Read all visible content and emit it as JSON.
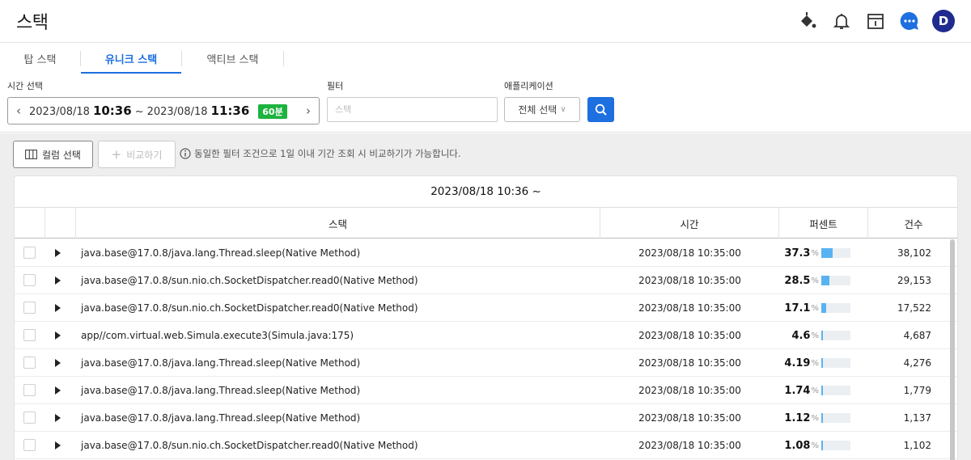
{
  "header": {
    "title": "스택"
  },
  "tabs": [
    {
      "label": "탑 스택",
      "active": false
    },
    {
      "label": "유니크 스택",
      "active": true
    },
    {
      "label": "액티브 스택",
      "active": false
    }
  ],
  "filters": {
    "time_label": "시간 선택",
    "range": {
      "start_date": "2023/08/18",
      "start_time": "10:36",
      "separator": "~",
      "end_date": "2023/08/18",
      "end_time": "11:36",
      "duration_badge": "60분"
    },
    "filter_label": "필터",
    "filter_placeholder": "스택",
    "app_label": "애플리케이션",
    "app_selected": "전체 선택"
  },
  "toolbar": {
    "column_select": "컬럼 선택",
    "compare": "비교하기",
    "info": "동일한 필터 조건으로 1일 이내 기간 조회 시 비교하기가 가능합니다."
  },
  "table": {
    "title": "2023/08/18 10:36 ~",
    "columns": [
      "스택",
      "시간",
      "퍼센트",
      "건수"
    ],
    "percent_symbol": "%",
    "rows": [
      {
        "stack": "java.base@17.0.8/java.lang.Thread.sleep(Native Method)",
        "time": "2023/08/18 10:35:00",
        "percent": "37.3",
        "fill": 0.373,
        "count": "38,102"
      },
      {
        "stack": "java.base@17.0.8/sun.nio.ch.SocketDispatcher.read0(Native Method)",
        "time": "2023/08/18 10:35:00",
        "percent": "28.5",
        "fill": 0.285,
        "count": "29,153"
      },
      {
        "stack": "java.base@17.0.8/sun.nio.ch.SocketDispatcher.read0(Native Method)",
        "time": "2023/08/18 10:35:00",
        "percent": "17.1",
        "fill": 0.171,
        "count": "17,522"
      },
      {
        "stack": "app//com.virtual.web.Simula.execute3(Simula.java:175)",
        "time": "2023/08/18 10:35:00",
        "percent": "4.6",
        "fill": 0.046,
        "count": "4,687"
      },
      {
        "stack": "java.base@17.0.8/java.lang.Thread.sleep(Native Method)",
        "time": "2023/08/18 10:35:00",
        "percent": "4.19",
        "fill": 0.0419,
        "count": "4,276"
      },
      {
        "stack": "java.base@17.0.8/java.lang.Thread.sleep(Native Method)",
        "time": "2023/08/18 10:35:00",
        "percent": "1.74",
        "fill": 0.0174,
        "count": "1,779"
      },
      {
        "stack": "java.base@17.0.8/java.lang.Thread.sleep(Native Method)",
        "time": "2023/08/18 10:35:00",
        "percent": "1.12",
        "fill": 0.0112,
        "count": "1,137"
      },
      {
        "stack": "java.base@17.0.8/sun.nio.ch.SocketDispatcher.read0(Native Method)",
        "time": "2023/08/18 10:35:00",
        "percent": "1.08",
        "fill": 0.0108,
        "count": "1,102"
      }
    ]
  },
  "colors": {
    "accent": "#1e6fe0",
    "badge": "#1db33f",
    "bar": "#59b3f1",
    "avatar": "#1f2b8f"
  },
  "icons": [
    "paint-bucket-icon",
    "bell-icon",
    "calendar-icon",
    "chat-icon",
    "user-avatar"
  ],
  "avatar_letter": "D"
}
